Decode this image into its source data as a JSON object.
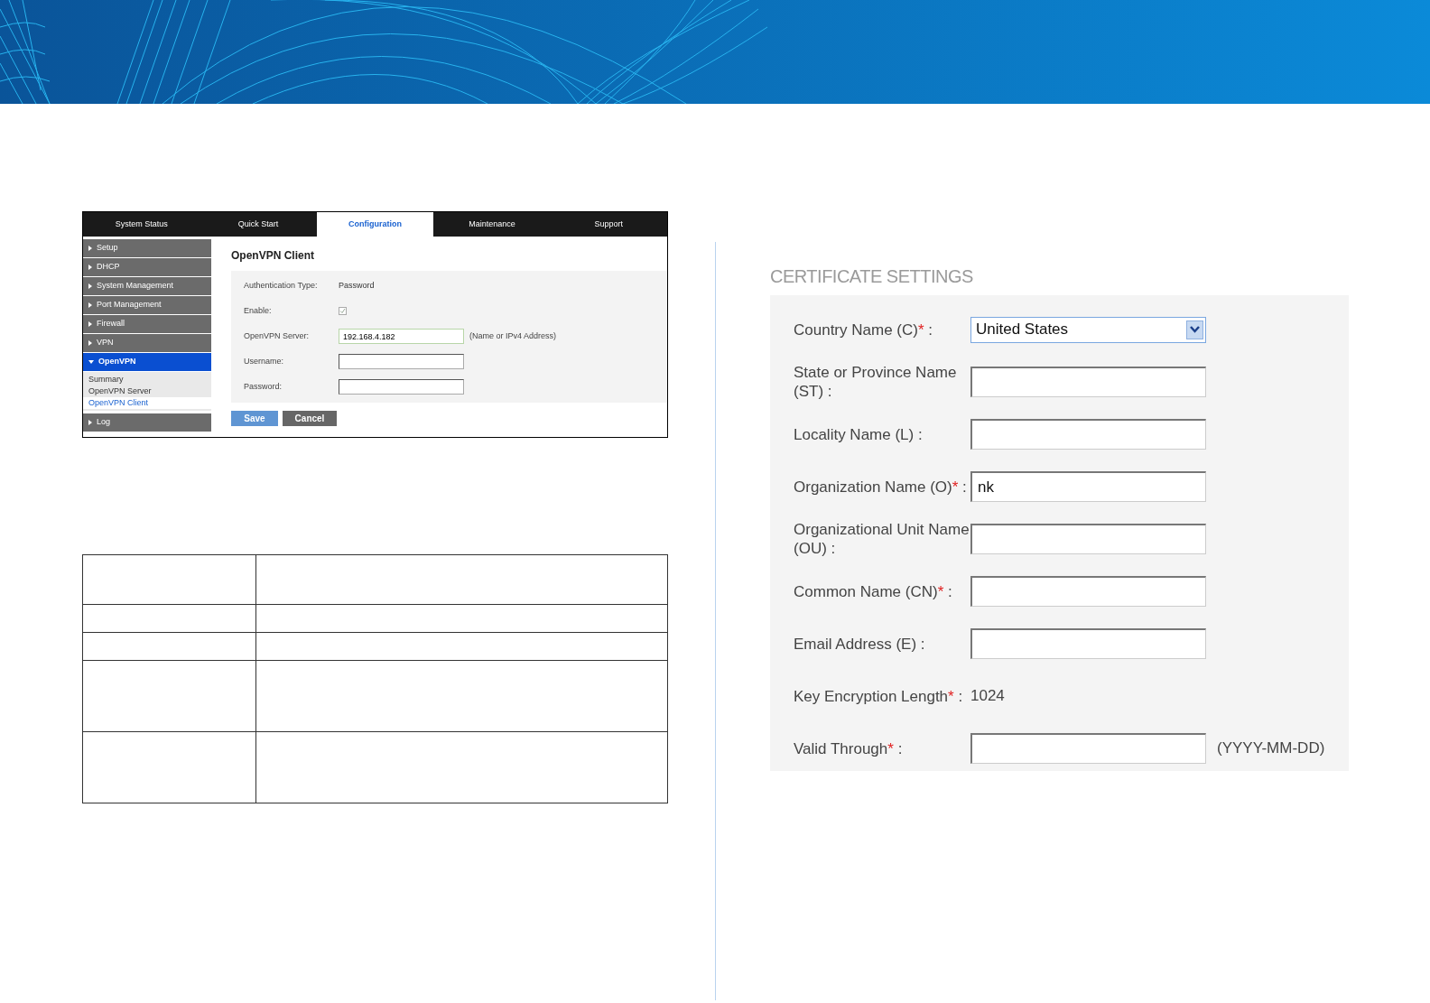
{
  "router_ui": {
    "tabs": [
      {
        "label": "System Status",
        "selected": false
      },
      {
        "label": "Quick Start",
        "selected": false
      },
      {
        "label": "Configuration",
        "selected": true
      },
      {
        "label": "Maintenance",
        "selected": false
      },
      {
        "label": "Support",
        "selected": false
      }
    ],
    "sidebar": {
      "items": [
        {
          "label": "Setup",
          "expanded": false
        },
        {
          "label": "DHCP",
          "expanded": false
        },
        {
          "label": "System Management",
          "expanded": false
        },
        {
          "label": "Port Management",
          "expanded": false
        },
        {
          "label": "Firewall",
          "expanded": false
        },
        {
          "label": "VPN",
          "expanded": false
        },
        {
          "label": "OpenVPN",
          "expanded": true,
          "children": [
            {
              "label": "Summary",
              "selected": false
            },
            {
              "label": "OpenVPN Server",
              "selected": false
            },
            {
              "label": "OpenVPN Client",
              "selected": true
            }
          ]
        },
        {
          "label": "Log",
          "expanded": false
        }
      ]
    },
    "title": "OpenVPN Client",
    "fields": [
      {
        "kind": "text",
        "label": "Authentication Type:",
        "value": "Password"
      },
      {
        "kind": "checkbox",
        "label": "Enable:",
        "checked": true
      },
      {
        "kind": "input",
        "label": "OpenVPN Server:",
        "value": "192.168.4.182",
        "hint": "(Name or IPv4 Address)"
      },
      {
        "kind": "input",
        "label": "Username:"
      },
      {
        "kind": "input",
        "label": "Password:"
      }
    ],
    "buttons": [
      {
        "label": "Save",
        "kind": "primary"
      },
      {
        "label": "Cancel",
        "kind": "secondary"
      }
    ]
  },
  "table": {
    "rows": [
      {
        "kind": "tall"
      },
      {
        "kind": "short"
      },
      {
        "kind": "short"
      },
      {
        "kind": "large"
      },
      {
        "kind": "large"
      }
    ]
  },
  "certificate_settings": {
    "title": "CERTIFICATE SETTINGS",
    "fields": [
      {
        "kind": "select",
        "label": "Country Name (C)",
        "mark": "*",
        "colon": ":",
        "value": "United States"
      },
      {
        "kind": "input",
        "label": "State or Province Name (ST)",
        "colon": ":"
      },
      {
        "kind": "input",
        "label": "Locality Name (L)",
        "colon": ":"
      },
      {
        "kind": "input",
        "label": "Organization Name (O)",
        "mark": "*",
        "colon": ":",
        "value": "nk"
      },
      {
        "kind": "input",
        "label": "Organizational Unit Name (OU)",
        "colon": ":"
      },
      {
        "kind": "input",
        "label": "Common Name (CN)",
        "mark": "*",
        "colon": ":"
      },
      {
        "kind": "input",
        "label": "Email Address (E)",
        "colon": ":"
      },
      {
        "kind": "text",
        "label": "Key Encryption Length",
        "mark": "*",
        "colon": ":",
        "value": "1024"
      },
      {
        "kind": "input",
        "label": "Valid Through",
        "mark": "*",
        "colon": ":",
        "hint": "(YYYY-MM-DD)"
      }
    ]
  }
}
